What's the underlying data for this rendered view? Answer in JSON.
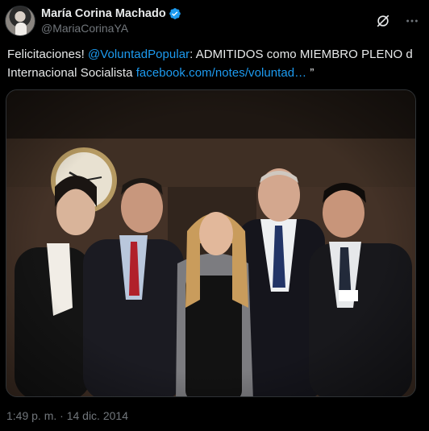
{
  "author": {
    "display_name": "María Corina Machado",
    "handle": "@MariaCorinaYA",
    "verified": true,
    "avatar_icon": "profile-photo"
  },
  "actions": {
    "grok_icon": "grok-icon",
    "more_icon": "more-icon"
  },
  "tweet": {
    "text_prefix": "Felicitaciones! ",
    "mention": "@VoluntadPopular",
    "text_middle": ": ADMITIDOS como MIEMBRO PLENO d Internacional Socialista ",
    "link_text": "facebook.com/notes/voluntad…",
    "text_suffix": " ”"
  },
  "media": {
    "type": "photo",
    "alt": ""
  },
  "footer": {
    "timestamp": "1:49 p. m. · 14 dic. 2014"
  },
  "colors": {
    "background": "#000000",
    "text": "#e7e9ea",
    "secondary": "#71767b",
    "link": "#1d9bf0",
    "verified": "#1d9bf0"
  }
}
